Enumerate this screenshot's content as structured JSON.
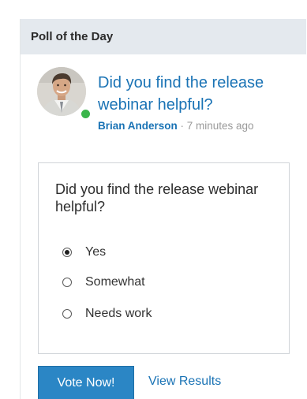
{
  "widget": {
    "title": "Poll of the Day"
  },
  "post": {
    "title": "Did you find the release webinar helpful?",
    "author": "Brian Anderson",
    "separator": " · ",
    "time": "7 minutes ago",
    "author_online": true,
    "avatar_icon": "user-avatar-photo"
  },
  "poll": {
    "question": "Did you find the release webinar helpful?",
    "options": [
      {
        "label": "Yes",
        "selected": true
      },
      {
        "label": "Somewhat",
        "selected": false
      },
      {
        "label": "Needs work",
        "selected": false
      }
    ]
  },
  "actions": {
    "vote_label": "Vote Now!",
    "results_label": "View Results"
  },
  "colors": {
    "header_bg": "#e4e9ee",
    "link": "#1a73b5",
    "button_bg": "#2b86c5",
    "online": "#3ab54a"
  }
}
